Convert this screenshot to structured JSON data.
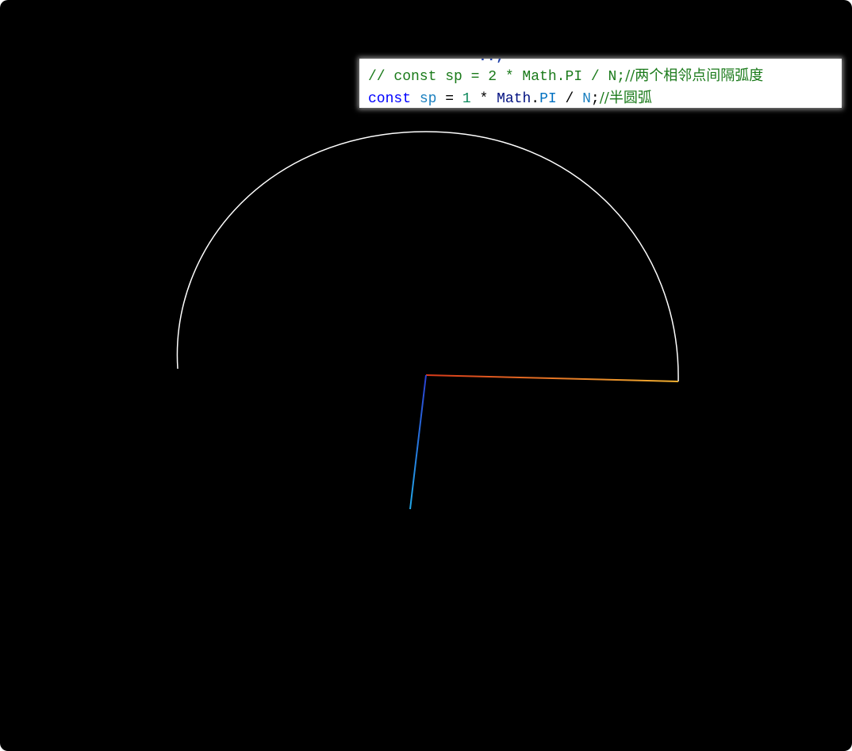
{
  "code_snippet": {
    "clipped_top_text": "..;",
    "line1": {
      "text": "// const sp = 2 * Math.PI / N;",
      "comment": "//两个相邻点间隔弧度"
    },
    "line2": {
      "keyword": "const",
      "var": "sp",
      "eq": " = ",
      "num": "1",
      "op": " * ",
      "obj": "Math",
      "dot": ".",
      "prop": "PI",
      "div": " / ",
      "n": "N",
      "semi": ";",
      "comment": "//半圆弧"
    }
  },
  "colors": {
    "background": "#000000",
    "arc": "#ffffff",
    "axis_up_top": "#d4e01a",
    "axis_up_bottom": "#2fc22f",
    "axis_right_start": "#d93a1a",
    "axis_right_end": "#f0b030",
    "axis_down_start": "#2a3fd0",
    "axis_down_end": "#22a8e8"
  }
}
